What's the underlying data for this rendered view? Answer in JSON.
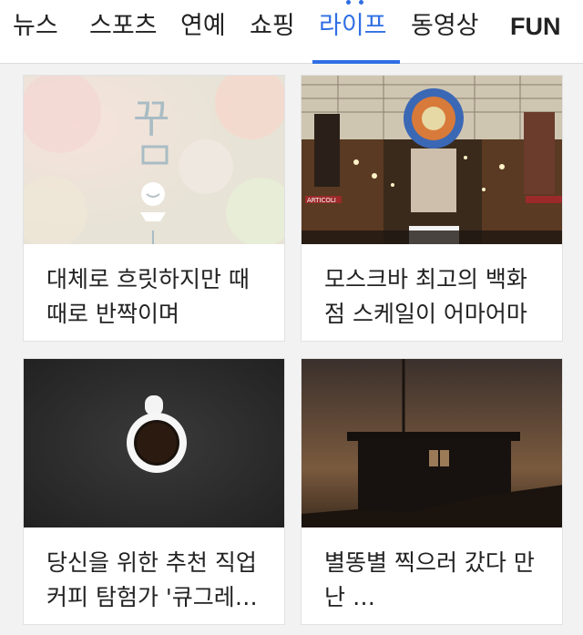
{
  "tabs": [
    {
      "label": "뉴스"
    },
    {
      "label": "스포츠"
    },
    {
      "label": "연예"
    },
    {
      "label": "쇼핑"
    },
    {
      "label": "라이프",
      "active": true
    },
    {
      "label": "동영상"
    },
    {
      "label": "FUN"
    }
  ],
  "colors": {
    "accent": "#2f6fe4",
    "background": "#f2f2f2",
    "card": "#ffffff"
  },
  "cards": [
    {
      "title": "대체로 흐릿하지만 때때로 반짝이며",
      "image_text": "꾸",
      "image": "pastel-bokeh-illustration"
    },
    {
      "title": "모스크바 최고의 백화점 스케일이 어마어마",
      "image_text": "ARTICOLI",
      "image": "department-store-interior"
    },
    {
      "title": "당신을 위한 추천 직업 커피 탐험가 '큐그레…",
      "image": "coffee-cup-top-view"
    },
    {
      "title": "별똥별 찍으러 갔다 만난 …",
      "image": "night-hut-silhouette"
    }
  ]
}
